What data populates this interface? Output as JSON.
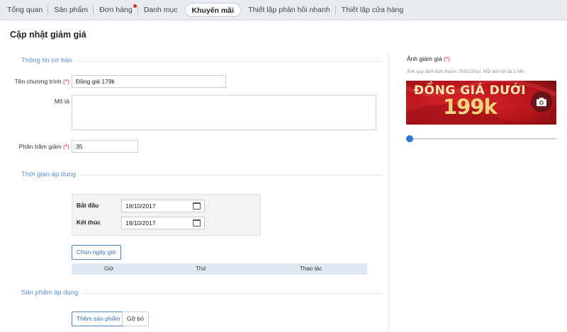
{
  "nav": {
    "tabs": [
      "Tổng quan",
      "Sản phẩm",
      "Đơn hàng",
      "Danh mục",
      "Khuyến mãi",
      "Thiết lập phản hồi nhanh",
      "Thiết lập cửa hàng"
    ],
    "active_tab": "Khuyến mãi"
  },
  "page": {
    "title": "Cập nhật giảm giá"
  },
  "basic_info": {
    "section_title": "Thông tin cơ bản",
    "name_label": "Tên chương trình",
    "name_value": "Đồng giá 179k",
    "desc_label": "Mô tả",
    "desc_value": "",
    "percent_label": "Phần trăm giảm",
    "percent_value": "35",
    "required_mark": "(*)"
  },
  "time": {
    "section_title": "Thời gian áp dụng",
    "start_label": "Bắt đầu",
    "start_value": "18/10/2017",
    "end_label": "Kết thúc",
    "end_value": "18/10/2017",
    "choose_hours_button": "Chọn ngày giờ",
    "table_headers": [
      "Giờ",
      "Thứ",
      "Thao tác"
    ]
  },
  "products": {
    "section_title": "Sản phẩm áp dụng",
    "add_button": "Thêm sản phẩm",
    "remove_button": "Gỡ bỏ"
  },
  "image_panel": {
    "title": "Ảnh giảm giá",
    "required_mark": "(*)",
    "hint": "Ảnh quy định kích thước 750x220px. Mỗi ảnh tối đa 1 Mb",
    "banner_text": "ĐỒNG GIÁ DƯỚI",
    "banner_price": "199k",
    "banner_colors": {
      "primary": "#c0171d",
      "dark": "#7a0d10",
      "text": "#f6d47c"
    },
    "slider_level": 0
  },
  "colors": {
    "accent": "#2f78d0",
    "required": "#e0262f",
    "section": "#5b8ed0"
  }
}
